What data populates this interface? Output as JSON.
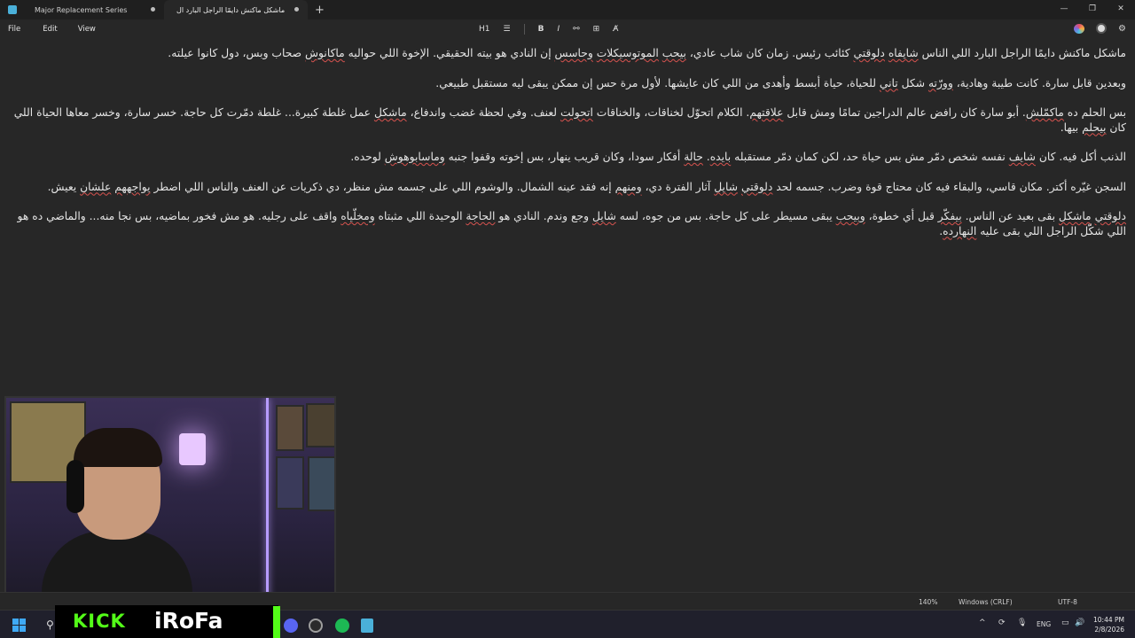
{
  "window": {
    "tabs": [
      {
        "label": "Major Replacement Series"
      },
      {
        "label": "ماشكل ماكنش دايمًا الراجل البارد ال"
      }
    ],
    "new_tab_glyph": "+",
    "controls": {
      "minimize": "—",
      "maximize": "❐",
      "close": "✕"
    }
  },
  "menu": {
    "file": "File",
    "edit": "Edit",
    "view": "View"
  },
  "toolbar": {
    "heading": "H1",
    "list": "☰",
    "bold": "B",
    "italic": "I",
    "link": "⚯",
    "table": "⊞",
    "clear_format": "A̸"
  },
  "paragraphs": [
    [
      "ماشكل ماكنش دايمًا الراجل البارد اللي الناس ",
      {
        "t": "شايفاه",
        "e": 1
      },
      " ",
      {
        "t": "دلوقتي",
        "e": 1
      },
      " كئائب رئيس. زمان كان شاب عادي، ",
      {
        "t": "بيحب",
        "e": 1
      },
      " ",
      {
        "t": "الموتوسيكلات",
        "e": 1
      },
      " ",
      {
        "t": "وحاسس",
        "e": 1
      },
      " إن النادي هو بيته الحقيقي. الإخوة اللي حواليه ",
      {
        "t": "ماكانوش",
        "e": 1
      },
      " صحاب وبس، دول كانوا عيلته."
    ],
    [
      "وبعدين قابل سارة. كانت طيبة وهادية، ",
      {
        "t": "وورّته",
        "e": 1
      },
      " شكل ",
      {
        "t": "تاني",
        "e": 1
      },
      " للحياة، حياة أبسط وأهدى من اللي كان عايشها. لأول مرة حس إن ممكن يبقى ليه مستقبل طبيعي."
    ],
    [
      "بس الحلم ده ",
      {
        "t": "ماكمّلش",
        "e": 1
      },
      ". أبو سارة كان رافض عالم الدراجين تمامًا ومش قابل ",
      {
        "t": "علاقتهم",
        "e": 1
      },
      ". الكلام اتحوّل لخناقات، والخناقات ",
      {
        "t": "اتحولت",
        "e": 1
      },
      " لعنف. وفي لحظة غضب واندفاع، ",
      {
        "t": "ماشكل",
        "e": 1
      },
      " عمل غلطة كبيرة... غلطة دمّرت كل حاجة. خسر سارة، وخسر معاها الحياة اللي كان ",
      {
        "t": "بيحلم",
        "e": 1
      },
      " بيها."
    ],
    [
      "الذنب أكل فيه. كان ",
      {
        "t": "شايف",
        "e": 1
      },
      " نفسه شخص دمّر مش بس حياة حد، لكن كمان دمّر مستقبله ",
      {
        "t": "بايده",
        "e": 1
      },
      ". ",
      {
        "t": "حالة",
        "e": 1
      },
      " أفكار سودا، وكان قريب ينهار، بس إخوته وقفوا جنبه ",
      {
        "t": "وماسابوهوش",
        "e": 1
      },
      " لوحده."
    ],
    [
      "السجن غيّره أكتر. مكان قاسي، والبقاء فيه كان محتاج قوة وضرب. جسمه لحد ",
      {
        "t": "دلوقتي",
        "e": 1
      },
      " ",
      {
        "t": "شايل",
        "e": 1
      },
      " آثار الفترة دي، ",
      {
        "t": "ومنهم",
        "e": 1
      },
      " إنه فقد عينه الشمال. والوشوم اللي على جسمه مش منظر، دي ذكريات عن العنف والناس اللي اضطر ",
      {
        "t": "يواجههم",
        "e": 1
      },
      " ",
      {
        "t": "علشان",
        "e": 1
      },
      " يعيش."
    ],
    [
      {
        "t": "دلوقتي",
        "e": 1
      },
      " ",
      {
        "t": "ماشكل",
        "e": 1
      },
      " بقى بعيد عن الناس. ",
      {
        "t": "بيفكّر",
        "e": 1
      },
      " قبل أي خطوة، ",
      {
        "t": "وبيحب",
        "e": 1
      },
      " يبقى مسيطر على كل حاجة. بس من جوه، لسه ",
      {
        "t": "شايل",
        "e": 1
      },
      " وجع وندم. النادي هو ",
      {
        "t": "الحاجة",
        "e": 1
      },
      " الوحيدة اللي مثبتاه ",
      {
        "t": "ومخلّياه",
        "e": 1
      },
      " واقف على رجليه. هو مش فخور بماضيه، بس نجا منه... والماضي ده هو اللي شكّل الراجل اللي بقى عليه ",
      {
        "t": "النهارده",
        "e": 1
      },
      "."
    ]
  ],
  "status": {
    "zoom": "140%",
    "line_endings": "Windows (CRLF)",
    "encoding": "UTF-8"
  },
  "overlay": {
    "kick": "KICK",
    "name": "iRoFa"
  },
  "tray": {
    "chevron": "^",
    "lang": "ENG"
  },
  "clock": {
    "time": "10:44 PM",
    "date": "2/8/2026"
  }
}
